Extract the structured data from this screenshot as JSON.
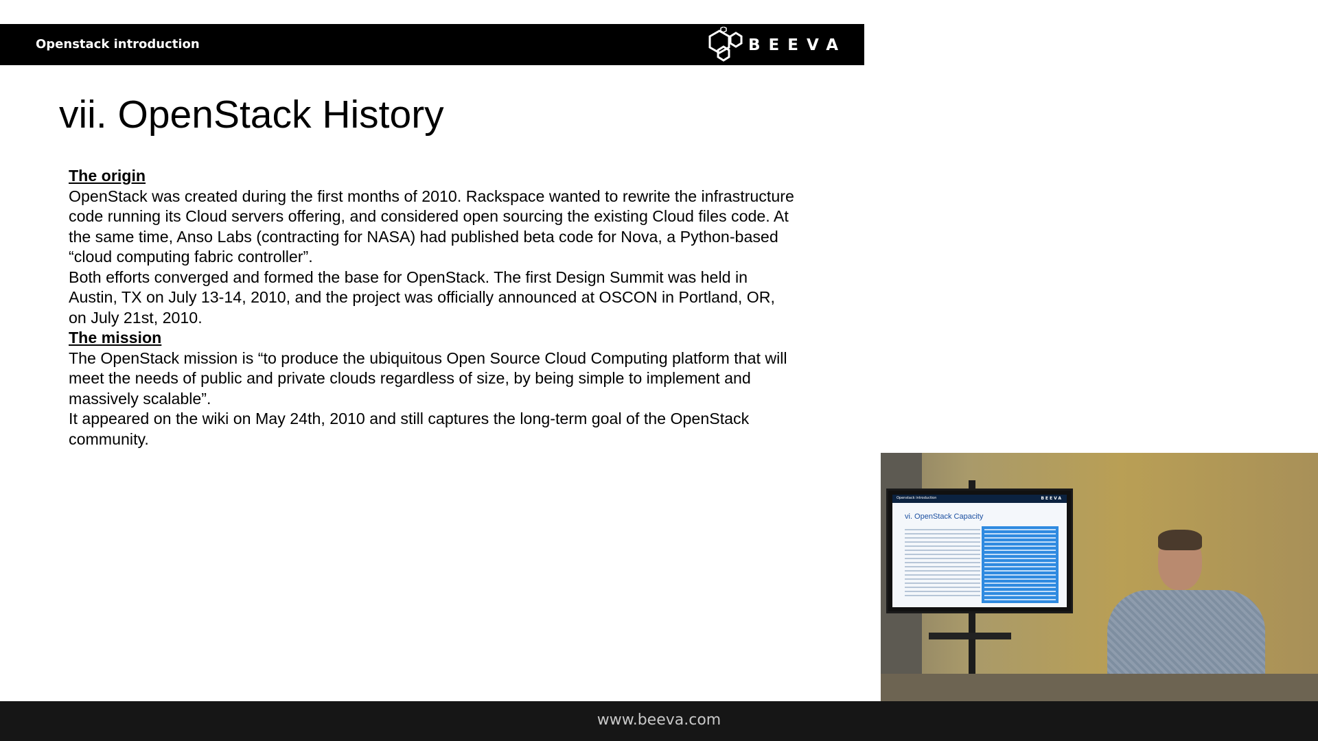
{
  "header": {
    "title": "Openstack introduction",
    "brand": "BEEVA"
  },
  "slide": {
    "title": "vii. OpenStack History",
    "origin_heading": "The origin",
    "origin_p1": "OpenStack was created during the first months of 2010. Rackspace wanted to rewrite the infrastructure code running its Cloud servers offering, and considered open sourcing the existing Cloud files code. At the same time, Anso Labs (contracting for NASA) had published beta code for Nova, a Python-based “cloud computing fabric controller”.",
    "origin_p2": "Both efforts converged and formed the base for OpenStack. The first Design Summit was held in Austin, TX on July 13-14, 2010, and the project was officially announced at OSCON in Portland, OR, on July 21st, 2010.",
    "mission_heading": "The mission",
    "mission_p1": "The OpenStack mission is “to produce the ubiquitous Open Source Cloud Computing platform that will meet the needs of public and private clouds regardless of size, by being simple to implement and massively scalable”.",
    "mission_p2": "It appeared on the wiki on May 24th, 2010 and still captures the long-term goal of the OpenStack community."
  },
  "video": {
    "tv_header": "Openstack introduction",
    "tv_brand": "BEEVA",
    "tv_title": "vi. OpenStack Capacity"
  },
  "footer": {
    "url": "www.beeva.com"
  },
  "colors": {
    "header_bg": "#000000",
    "footer_bg": "#161616",
    "text": "#000000"
  }
}
